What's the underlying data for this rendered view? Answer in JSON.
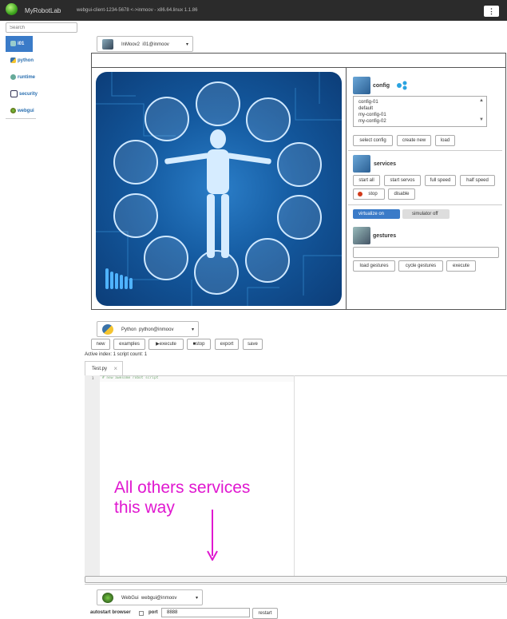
{
  "topbar": {
    "app_title": "MyRobotLab",
    "client_id": "webgui-client-1234-5678 <->inmoov - x86.64.linux 1.1.86",
    "menu_icon": "⋮"
  },
  "sidebar": {
    "search_placeholder": "Search",
    "items": [
      {
        "label": "i01",
        "icon": "robot-icon",
        "active": true
      },
      {
        "label": "python",
        "icon": "python-icon"
      },
      {
        "label": "runtime",
        "icon": "runtime-icon"
      },
      {
        "label": "security",
        "icon": "security-icon"
      },
      {
        "label": "webgui",
        "icon": "webgui-icon"
      }
    ]
  },
  "inmoov_panel": {
    "select_name": "InMoov2",
    "select_id": "i01@inmoov",
    "config": {
      "title": "config",
      "options": [
        "config-01",
        "default",
        "my-config-01",
        "my-config-02"
      ],
      "buttons": [
        "select config",
        "create new",
        "load"
      ]
    },
    "services": {
      "title": "services",
      "buttons": [
        "start all",
        "start servos",
        "full speed",
        "half speed"
      ],
      "stop_label": "stop",
      "disable_label": "disable",
      "virtualize_on": "virtualize on",
      "simulator_off": "simulator off"
    },
    "gestures": {
      "title": "gestures",
      "buttons": [
        "load gestures",
        "cycle gestures",
        "execute"
      ]
    }
  },
  "python_panel": {
    "select_name": "Python",
    "select_id": "python@inmoov",
    "buttons": {
      "new": "new",
      "examples": "examples",
      "execute": "execute",
      "stop": "stop",
      "export": "export",
      "save": "save"
    },
    "status": "Active index: 1 script count: 1",
    "tab_label": "Test.py",
    "tab_close": "×",
    "line_number": "1",
    "code_line": "# new awesome robot script"
  },
  "annotation": {
    "line1": "All others services",
    "line2": "this way"
  },
  "webgui_panel": {
    "select_name": "WebGui",
    "select_id": "webgui@inmoov",
    "autostart_label": "autostart browser",
    "port_label": "port",
    "port_value": "8888",
    "restart_label": "restart"
  },
  "colors": {
    "accent": "#3a7bc8",
    "annotation": "#e018d0",
    "robot_bg": "#145aa0",
    "topbar": "#2b2b2b"
  }
}
